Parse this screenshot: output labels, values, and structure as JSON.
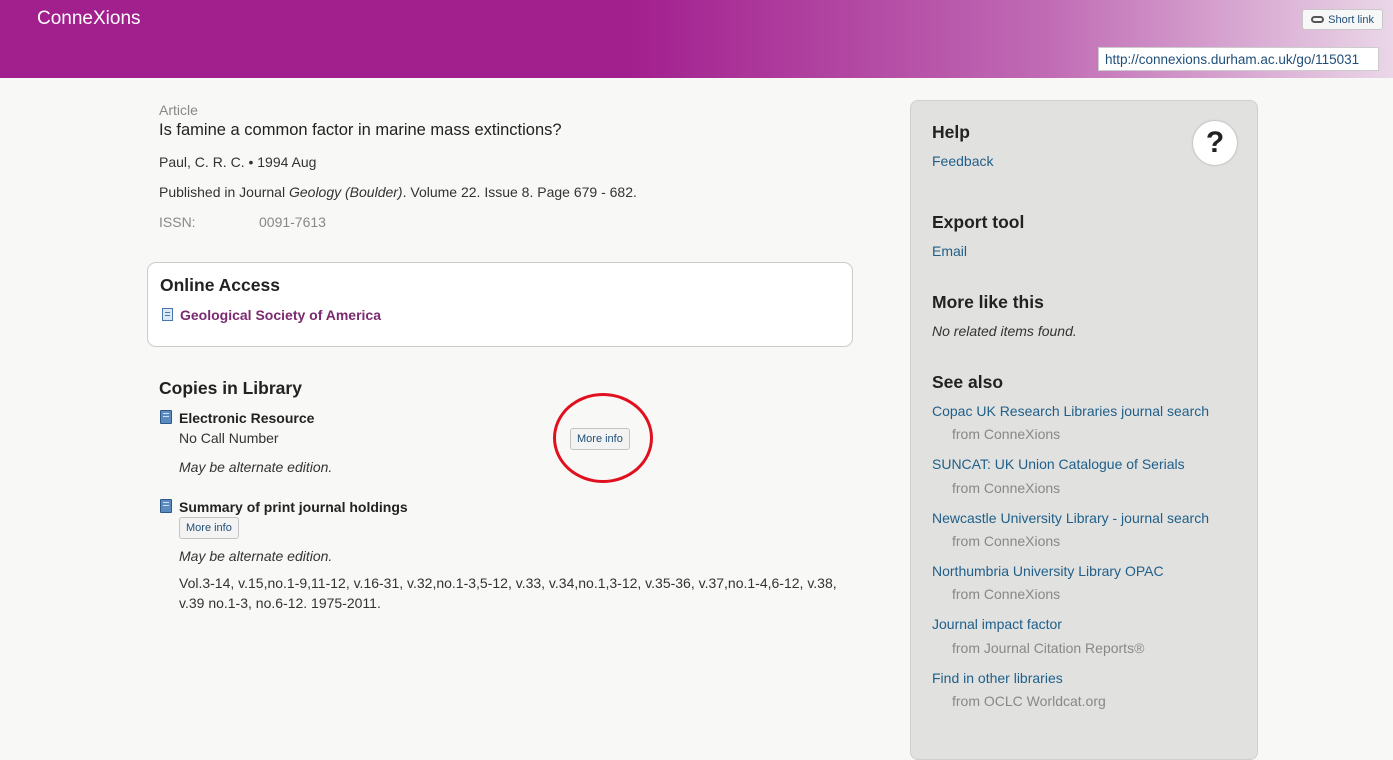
{
  "header": {
    "brand": "ConneXions",
    "short_link_label": "Short link",
    "url": "http://connexions.durham.ac.uk/go/115031"
  },
  "record": {
    "type": "Article",
    "title": "Is famine a common factor in marine mass extinctions?",
    "authors": "Paul, C. R. C. • 1994 Aug",
    "published_prefix": "Published in Journal ",
    "journal": "Geology (Boulder)",
    "published_suffix": ". Volume 22. Issue 8. Page 679 - 682.",
    "issn_label": "ISSN:",
    "issn_value": "0091-7613"
  },
  "online_access": {
    "title": "Online Access",
    "link": "Geological Society of America"
  },
  "copies": {
    "title": "Copies in Library",
    "items": [
      {
        "title": "Electronic Resource",
        "call_number": "No Call Number",
        "button": "More info",
        "note": "May be alternate edition."
      },
      {
        "title": "Summary of print journal holdings",
        "button": "More info",
        "note": "May be alternate edition.",
        "holdings": "Vol.3-14, v.15,no.1-9,11-12, v.16-31, v.32,no.1-3,5-12, v.33, v.34,no.1,3-12, v.35-36, v.37,no.1-4,6-12, v.38, v.39 no.1-3, no.6-12. 1975-2011."
      }
    ]
  },
  "sidebar": {
    "help_title": "Help",
    "help_icon_glyph": "?",
    "feedback": "Feedback",
    "export_title": "Export tool",
    "email": "Email",
    "more_like_title": "More like this",
    "more_like_note": "No related items found.",
    "see_also_title": "See also",
    "see_also": [
      {
        "link": "Copac UK Research Libraries journal search",
        "from": "from ConneXions"
      },
      {
        "link": "SUNCAT: UK Union Catalogue of Serials",
        "from": "from ConneXions"
      },
      {
        "link": "Newcastle University Library - journal search",
        "from": "from ConneXions"
      },
      {
        "link": "Northumbria University Library OPAC",
        "from": "from ConneXions"
      },
      {
        "link": "Journal impact factor",
        "from": "from Journal Citation Reports®"
      },
      {
        "link": "Find in other libraries",
        "from": "from OCLC Worldcat.org"
      }
    ]
  },
  "colors": {
    "header_purple": "#a21f8e",
    "link_blue": "#1f5f8a",
    "online_link_purple": "#7a2a6f",
    "highlight_red": "#e0101e"
  }
}
